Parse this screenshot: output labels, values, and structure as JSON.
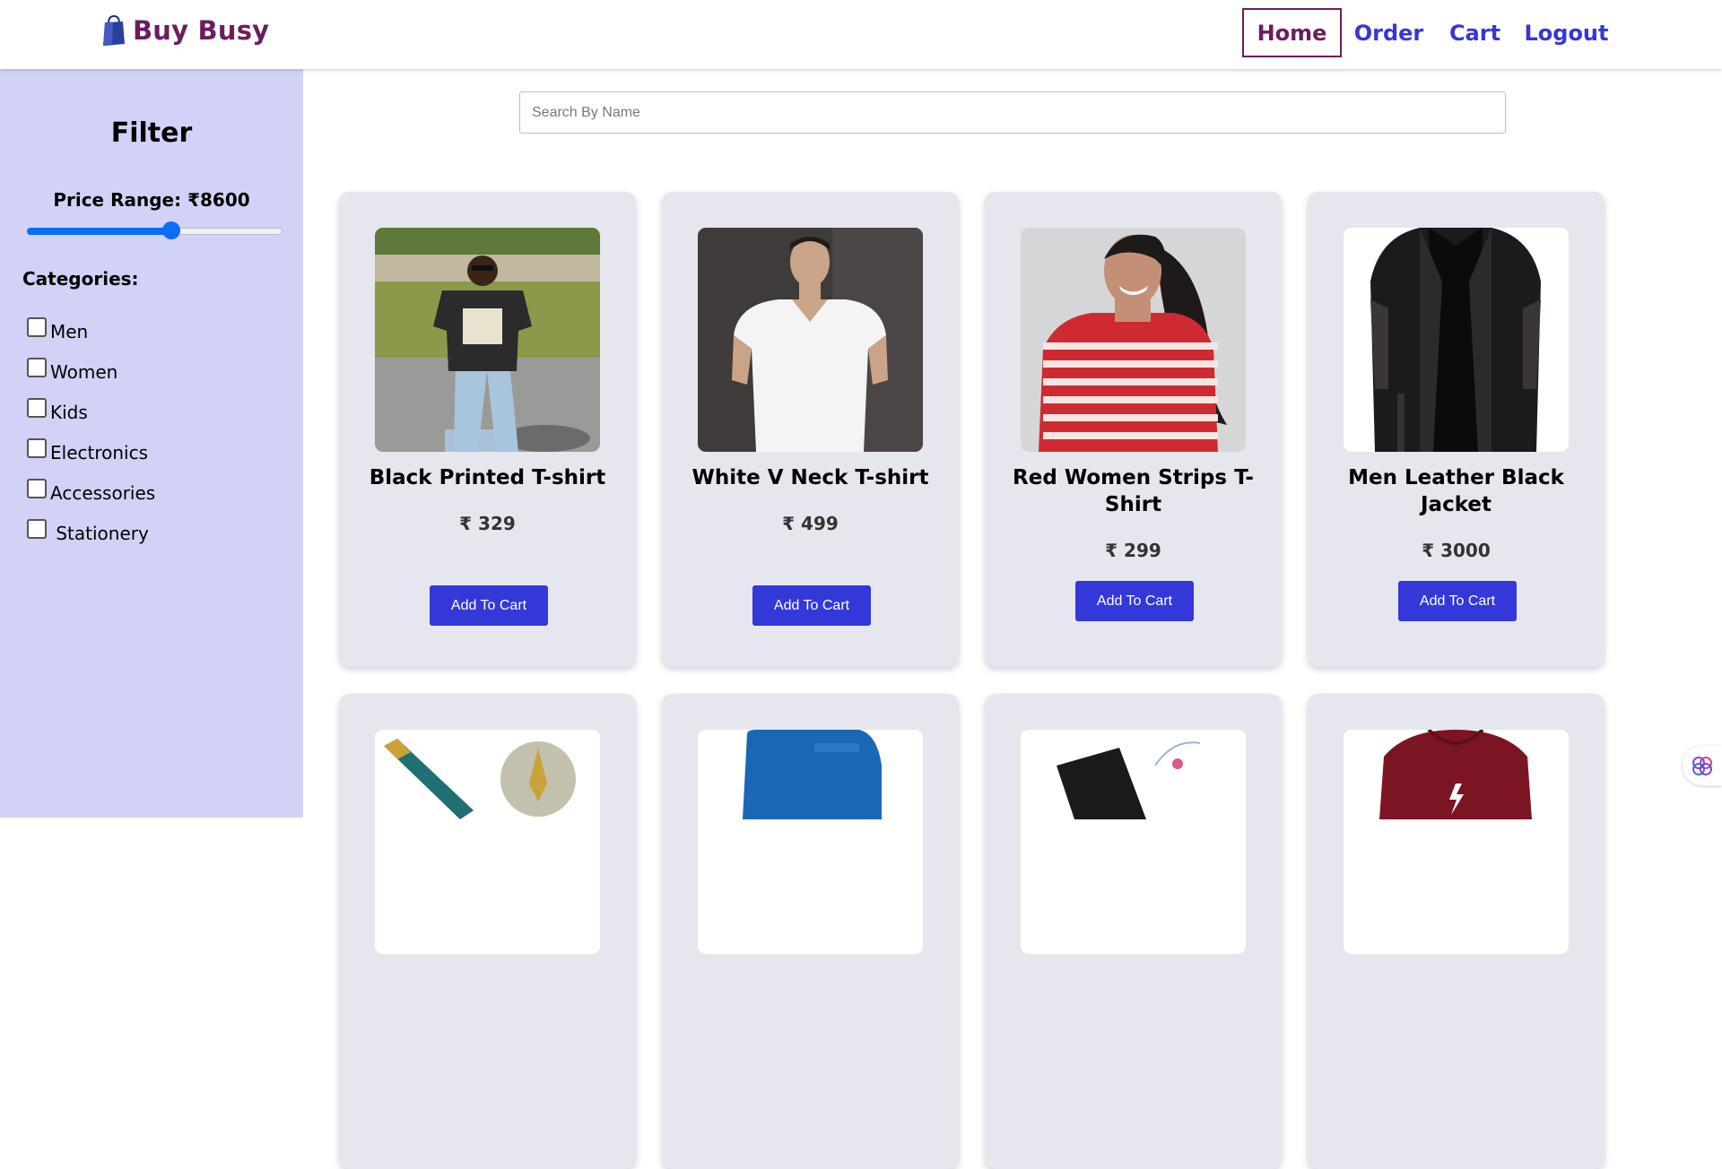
{
  "brand": {
    "name": "Buy Busy",
    "icon": "shopping-bag-icon",
    "color": "#6b1d5e"
  },
  "nav": {
    "home": "Home",
    "order": "Order",
    "cart": "Cart",
    "logout": "Logout",
    "active": "Home",
    "link_color": "#3537d6"
  },
  "search": {
    "placeholder": "Search By Name",
    "value": ""
  },
  "filter": {
    "title": "Filter",
    "price_label": "Price Range: ₹8600",
    "price_value": 8600,
    "slider_fraction": 0.565,
    "categories_label": "Categories:",
    "categories": [
      {
        "label": "Men",
        "checked": false
      },
      {
        "label": "Women",
        "checked": false
      },
      {
        "label": "Kids",
        "checked": false
      },
      {
        "label": "Electronics",
        "checked": false
      },
      {
        "label": "Accessories",
        "checked": false
      },
      {
        "label": " Stationery",
        "checked": false
      }
    ]
  },
  "products": [
    {
      "name": "Black Printed T-shirt",
      "price": "₹ 329",
      "button": "Add To Cart"
    },
    {
      "name": "White V Neck T-shirt",
      "price": "₹ 499",
      "button": "Add To Cart"
    },
    {
      "name": "Red Women Strips T-Shirt",
      "price": "₹ 299",
      "button": "Add To Cart"
    },
    {
      "name": "Men Leather Black Jacket",
      "price": "₹ 3000",
      "button": "Add To Cart"
    }
  ],
  "colors": {
    "sidebar_bg": "#d2d2f7",
    "button_bg": "#3438d8",
    "card_bg": "#e6e6ee",
    "slider": "#0b6ef5"
  }
}
